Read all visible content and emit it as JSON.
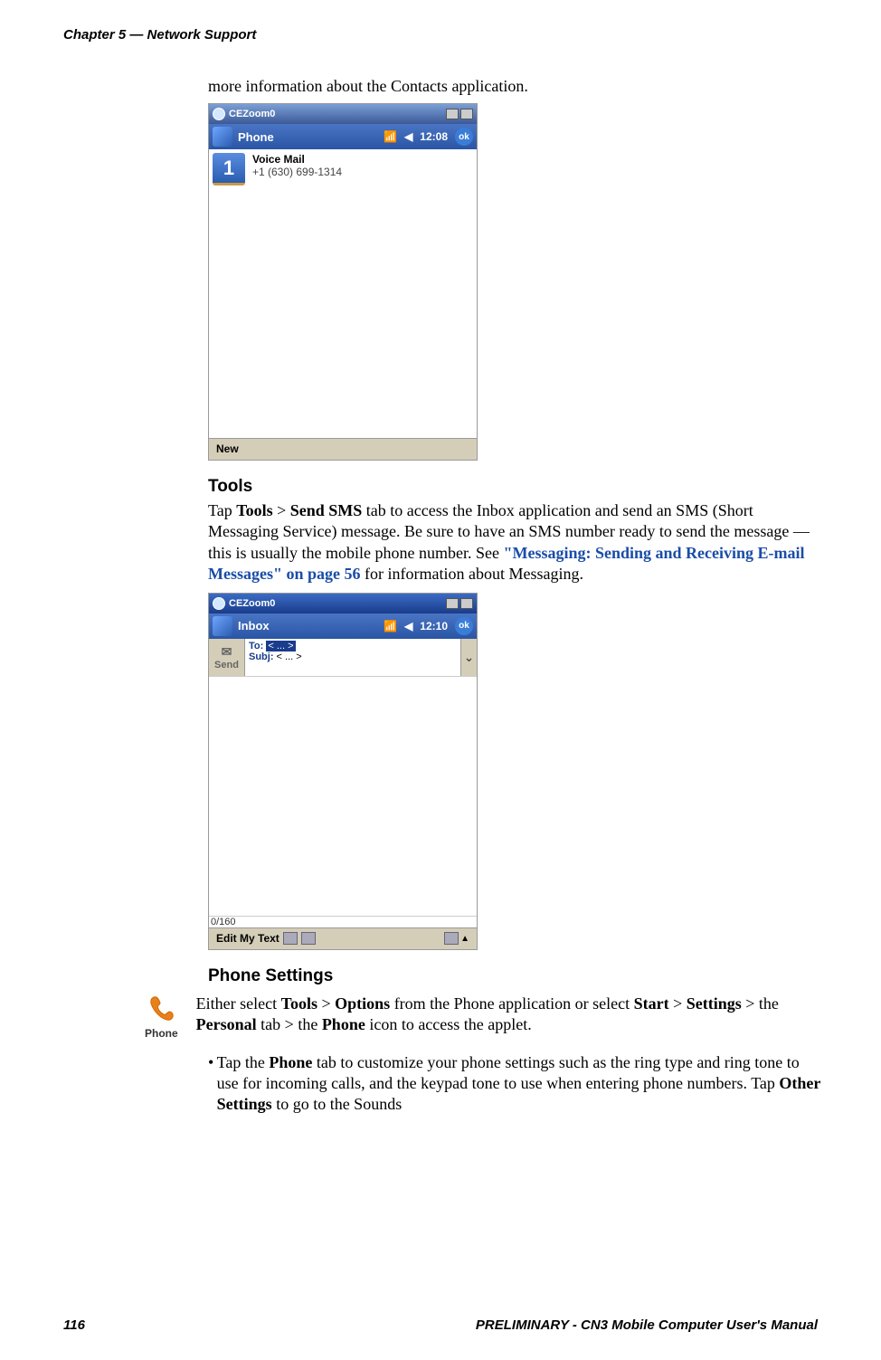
{
  "header": "Chapter 5 — Network Support",
  "intro": "more information about the Contacts application.",
  "ss1": {
    "title": "CEZoom0",
    "bar": "Phone",
    "time": "12:08",
    "ok": "ok",
    "num": "1",
    "item_title": "Voice Mail",
    "item_sub": "+1 (630) 699-1314",
    "bottom": "New"
  },
  "tools": {
    "heading": "Tools",
    "p1a": "Tap ",
    "p1b": "Tools",
    "p1c": " > ",
    "p1d": "Send SMS",
    "p1e": " tab to access the Inbox application and send an SMS (Short Messaging Service) message. Be sure to have an SMS number ready to send the message — this is usually the mobile phone number. See ",
    "link": "\"Messaging: Sending and Receiving E-mail Messages\" on page 56",
    "p1f": " for information about Messaging."
  },
  "ss2": {
    "title": "CEZoom0",
    "bar": "Inbox",
    "time": "12:10",
    "ok": "ok",
    "send": "Send",
    "to_label": "To:",
    "to_val": "< ... >",
    "subj_label": "Subj:",
    "subj_val": " < ... >",
    "counter": "0/160",
    "bottom": "Edit My Text"
  },
  "phone": {
    "heading": "Phone Settings",
    "icon_label": "Phone",
    "p1a": "Either select ",
    "p1b": "Tools",
    "p1c": " > ",
    "p1d": "Options",
    "p1e": " from the Phone application or select ",
    "p1f": "Start",
    "p1g": " > ",
    "p1h": "Settings",
    "p1i": " > the ",
    "p1j": "Personal",
    "p1k": " tab > the ",
    "p1l": "Phone",
    "p1m": " icon to access the applet.",
    "bullet_a": "Tap the ",
    "bullet_b": "Phone",
    "bullet_c": " tab to customize your phone settings such as the ring type and ring tone to use for incoming calls, and the keypad tone to use when entering phone numbers. Tap ",
    "bullet_d": "Other Settings",
    "bullet_e": " to go to the Sounds"
  },
  "footer": {
    "page": "116",
    "title": "PRELIMINARY - CN3 Mobile Computer User's Manual"
  }
}
